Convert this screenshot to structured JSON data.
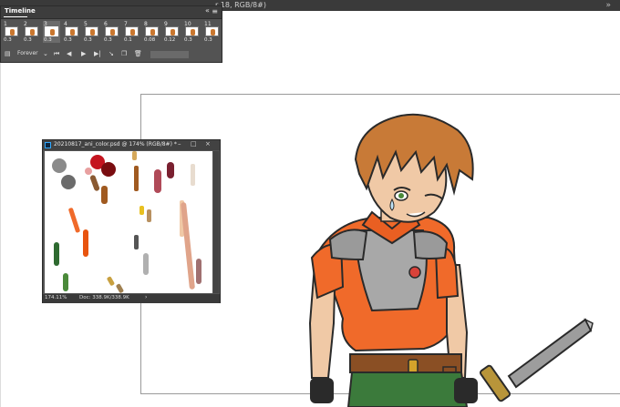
{
  "document_tab": {
    "label": "r 18, RGB/8#)"
  },
  "timeline": {
    "title": "Timeline",
    "frames": [
      {
        "number": "1",
        "delay": "0.3"
      },
      {
        "number": "2",
        "delay": "0.3"
      },
      {
        "number": "3",
        "delay": "0.3"
      },
      {
        "number": "4",
        "delay": "0.3"
      },
      {
        "number": "5",
        "delay": "0.3"
      },
      {
        "number": "6",
        "delay": "0.3"
      },
      {
        "number": "7",
        "delay": "0.1"
      },
      {
        "number": "8",
        "delay": "0.08"
      },
      {
        "number": "9",
        "delay": "0.12"
      },
      {
        "number": "10",
        "delay": "0.3"
      },
      {
        "number": "11",
        "delay": "0.3"
      }
    ],
    "loop_option": "Forever"
  },
  "doc_window": {
    "title": "20210817_ani_color.psd @ 174% (RGB/8#) *",
    "zoom": "174.11%",
    "doc_size": "Doc: 338.9K/338.9K"
  },
  "colors": {
    "skin": "#f0c9a6",
    "hair": "#c87a37",
    "shirt": "#f06a2a",
    "armor": "#a8a8a8"
  }
}
